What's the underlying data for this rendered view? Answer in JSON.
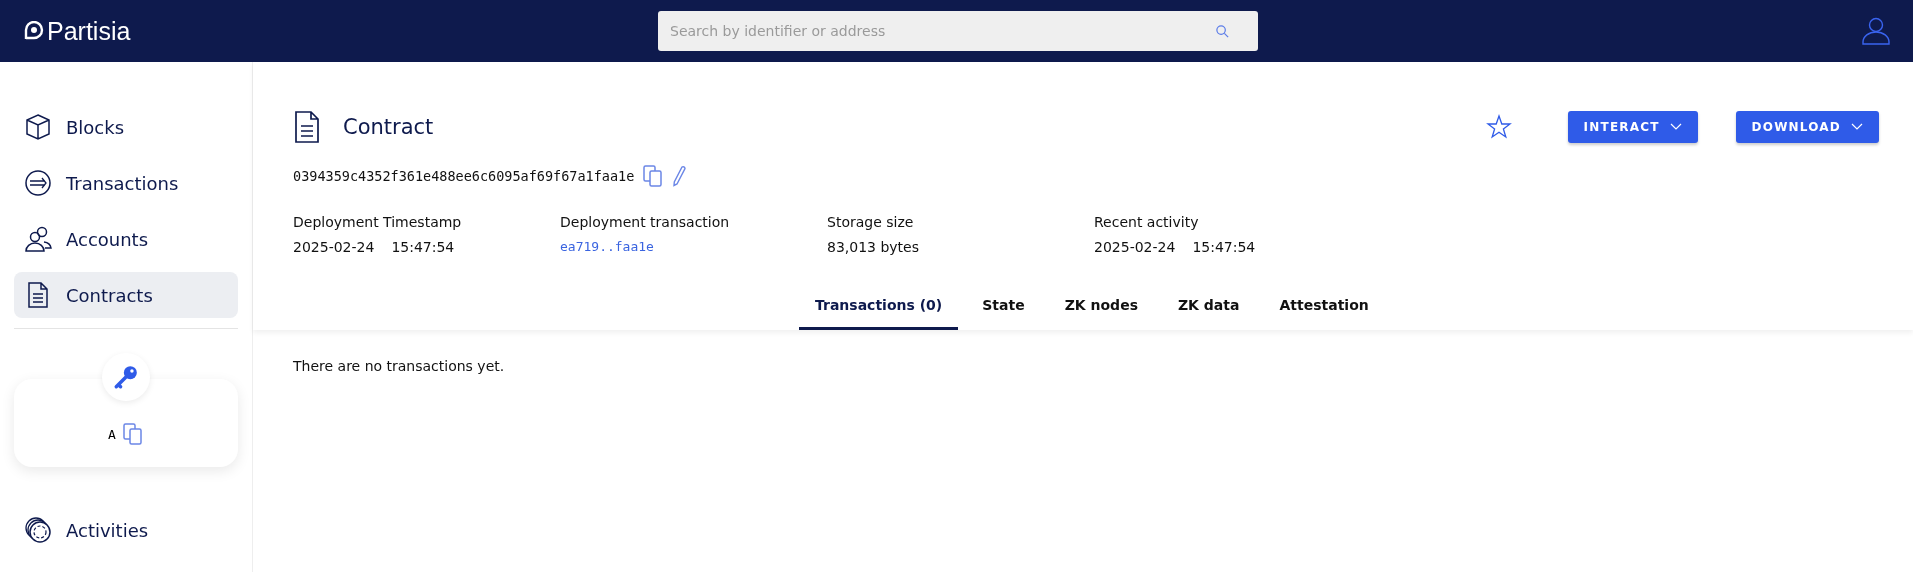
{
  "header": {
    "logo": "Partisia",
    "search": {
      "placeholder": "Search by identifier or address"
    }
  },
  "sidebar": {
    "items": [
      {
        "label": "Blocks",
        "selected": false
      },
      {
        "label": "Transactions",
        "selected": false
      },
      {
        "label": "Accounts",
        "selected": false
      },
      {
        "label": "Contracts",
        "selected": true
      }
    ],
    "key_card": {
      "label": "A"
    },
    "bottom_items": [
      {
        "label": "Activities",
        "selected": false
      }
    ]
  },
  "contract": {
    "title": "Contract",
    "address": "0394359c4352f361e488ee6c6095af69f67a1faa1e",
    "favorite": false,
    "buttons": [
      "INTERACT",
      "DOWNLOAD"
    ],
    "info": [
      {
        "label": "Deployment Timestamp",
        "kind": "datetime",
        "date": "2025-02-24",
        "time": "15:47:54"
      },
      {
        "label": "Deployment transaction",
        "kind": "link",
        "value": "ea719..faa1e"
      },
      {
        "label": "Storage size",
        "kind": "text",
        "value": "83,013 bytes"
      },
      {
        "label": "Recent activity",
        "kind": "datetime",
        "date": "2025-02-24",
        "time": "15:47:54"
      }
    ],
    "tabs": [
      {
        "label": "Transactions (0)",
        "selected": true
      },
      {
        "label": "State",
        "selected": false
      },
      {
        "label": "ZK nodes",
        "selected": false
      },
      {
        "label": "ZK data",
        "selected": false
      },
      {
        "label": "Attestation",
        "selected": false
      }
    ]
  },
  "empty_message": "There are no transactions yet."
}
